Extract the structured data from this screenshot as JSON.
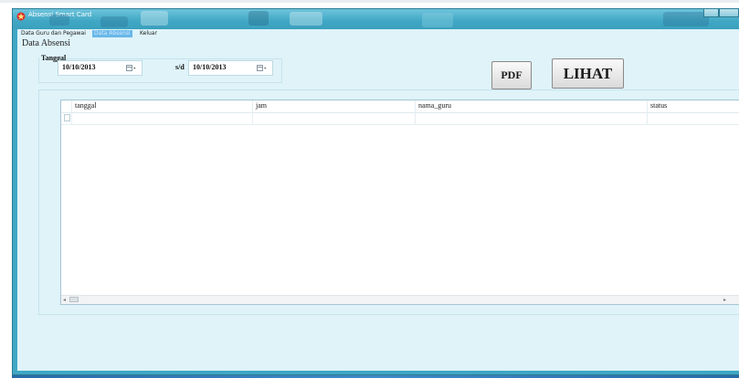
{
  "window": {
    "title": "Absensi Smart Card",
    "accent": "#3fa7c4",
    "client_bg": "#dff3f9"
  },
  "menu": {
    "items": [
      {
        "label": "Data Guru dan Pegawai"
      },
      {
        "label": "Data Absensi"
      },
      {
        "label": "Keluar"
      }
    ],
    "active_index": 1
  },
  "page": {
    "title": "Data Absensi"
  },
  "filter": {
    "group_label": "Tanggal",
    "from_date": "10/10/2013",
    "separator": "s/d",
    "to_date": "10/10/2013"
  },
  "buttons": {
    "pdf": "PDF",
    "lihat": "LIHAT"
  },
  "grid": {
    "columns": [
      "tanggal",
      "jam",
      "nama_guru",
      "status"
    ],
    "rows": []
  },
  "icons": {
    "app": "app-icon",
    "date_dropdown": "calendar-dropdown-icon",
    "scroll_left": "scroll-left-arrow-icon",
    "scroll_right": "scroll-right-arrow-icon"
  }
}
